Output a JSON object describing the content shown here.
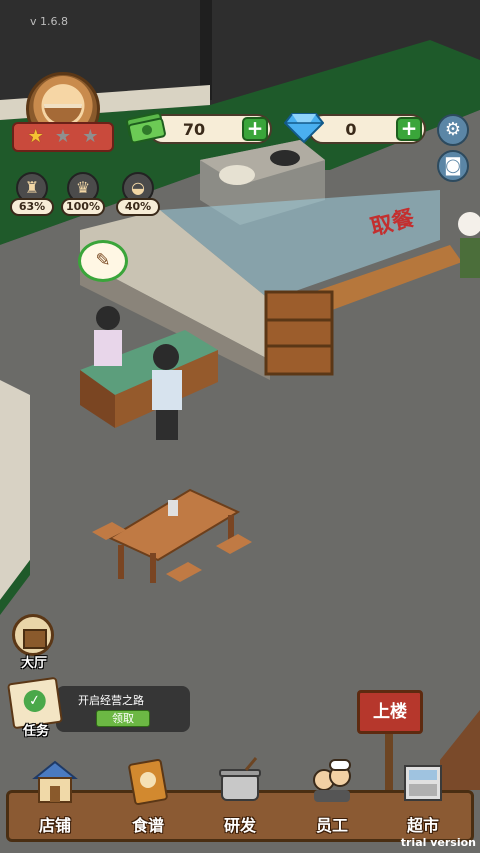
{
  "version": "v 1.6.8",
  "restaurant": {
    "stars_on": 1,
    "stars_total": 3
  },
  "currency": {
    "cash": {
      "value": "70",
      "icon": "cash-icon"
    },
    "gems": {
      "value": "0",
      "icon": "diamond-icon"
    }
  },
  "buttons": {
    "settings_icon": "gear-icon",
    "camera_icon": "camera-icon"
  },
  "stats": [
    {
      "icon": "armchair-icon",
      "value": "63%"
    },
    {
      "icon": "chef-hat-icon",
      "value": "100%"
    },
    {
      "icon": "noodle-bowl-icon",
      "value": "40%"
    }
  ],
  "scene": {
    "pickup_sign": "取餐"
  },
  "side": {
    "hall_label": "大厅",
    "task_label": "任务",
    "task_title": "开启经营之路",
    "claim_label": "领取"
  },
  "upstairs_label": "上楼",
  "nav": [
    {
      "label": "店铺",
      "icon": "shop-icon"
    },
    {
      "label": "食谱",
      "icon": "recipe-book-icon"
    },
    {
      "label": "研发",
      "icon": "cooking-pot-icon"
    },
    {
      "label": "员工",
      "icon": "staff-icon"
    },
    {
      "label": "超市",
      "icon": "supermarket-icon"
    }
  ],
  "trial_text": "trial version",
  "colors": {
    "accent_green": "#3aa53a",
    "banner_red": "#c94a3c",
    "wood": "#8b5a33"
  }
}
